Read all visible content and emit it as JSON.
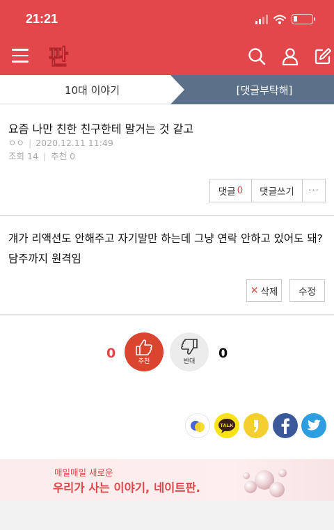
{
  "status": {
    "time": "21:21"
  },
  "header": {
    "logo_text": "판",
    "icons": [
      "menu-icon",
      "search-icon",
      "user-icon",
      "write-icon"
    ]
  },
  "tabs": {
    "left": "10대 이야기",
    "right": "[댓글부탁해]"
  },
  "post": {
    "title": "요즘 나만 친한 친구한테 말거는 것 같고",
    "author": "ㅇㅇ",
    "date": "2020.12.11 11:49",
    "views_label": "조회",
    "views": "14",
    "recommend_label": "추천",
    "recommend": "0",
    "comment_label": "댓글",
    "comment_count": "0",
    "write_comment": "댓글쓰기",
    "more": "···"
  },
  "content": {
    "body": "걔가 리액션도 안해주고 자기말만 하는데 그냥 연락 안하고 있어도 돼? 담주까지 원격임",
    "delete_label": "삭제",
    "edit_label": "수정"
  },
  "vote": {
    "up_count": "0",
    "up_label": "추천",
    "down_label": "반대",
    "down_count": "0"
  },
  "share": {
    "kakao_talk": "TALK"
  },
  "banner": {
    "sub": "매일매일 새로운",
    "main": "우리가 사는 이야기, 네이트판."
  },
  "colors": {
    "brand": "#e2474b",
    "tab_active": "#5b7189"
  }
}
